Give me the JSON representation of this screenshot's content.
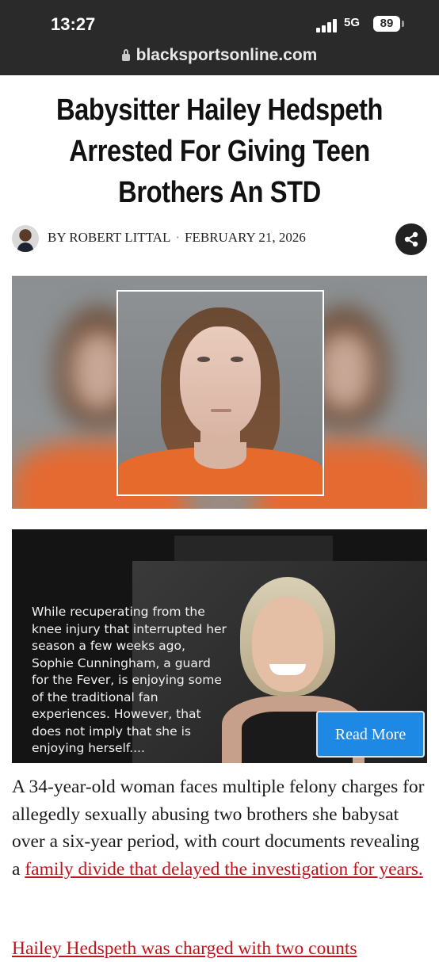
{
  "status_bar": {
    "time": "13:27",
    "network": "5G",
    "battery": "89"
  },
  "browser": {
    "url": "blacksportsonline.com"
  },
  "article": {
    "headline": "Babysitter Hailey Hedspeth Arrested For Giving Teen Brothers An STD",
    "byline": "BY ROBERT LITTAL",
    "separator": "·",
    "date": "FEBRUARY 21, 2026",
    "share_icon": "share-icon",
    "body_text_before_link": "A 34-year-old woman faces multiple felony charges for allegedly sexually abusing two brothers she babysat over a six-year period, with court documents revealing a ",
    "body_link_text": "family divide that delayed the investigation for years.",
    "next_paragraph_partial": "Hailey Hedspeth was charged with two counts"
  },
  "related_ad": {
    "text": "While recuperating from the knee injury that interrupted her season a few weeks ago, Sophie Cunningham, a guard for the Fever, is enjoying some of the traditional fan experiences. However, that does not imply that she is enjoying herself....",
    "button_label": "Read More"
  },
  "colors": {
    "link": "#c0141a",
    "read_more_bg": "#1e88e5",
    "status_bar_bg": "#2a2a2a"
  }
}
